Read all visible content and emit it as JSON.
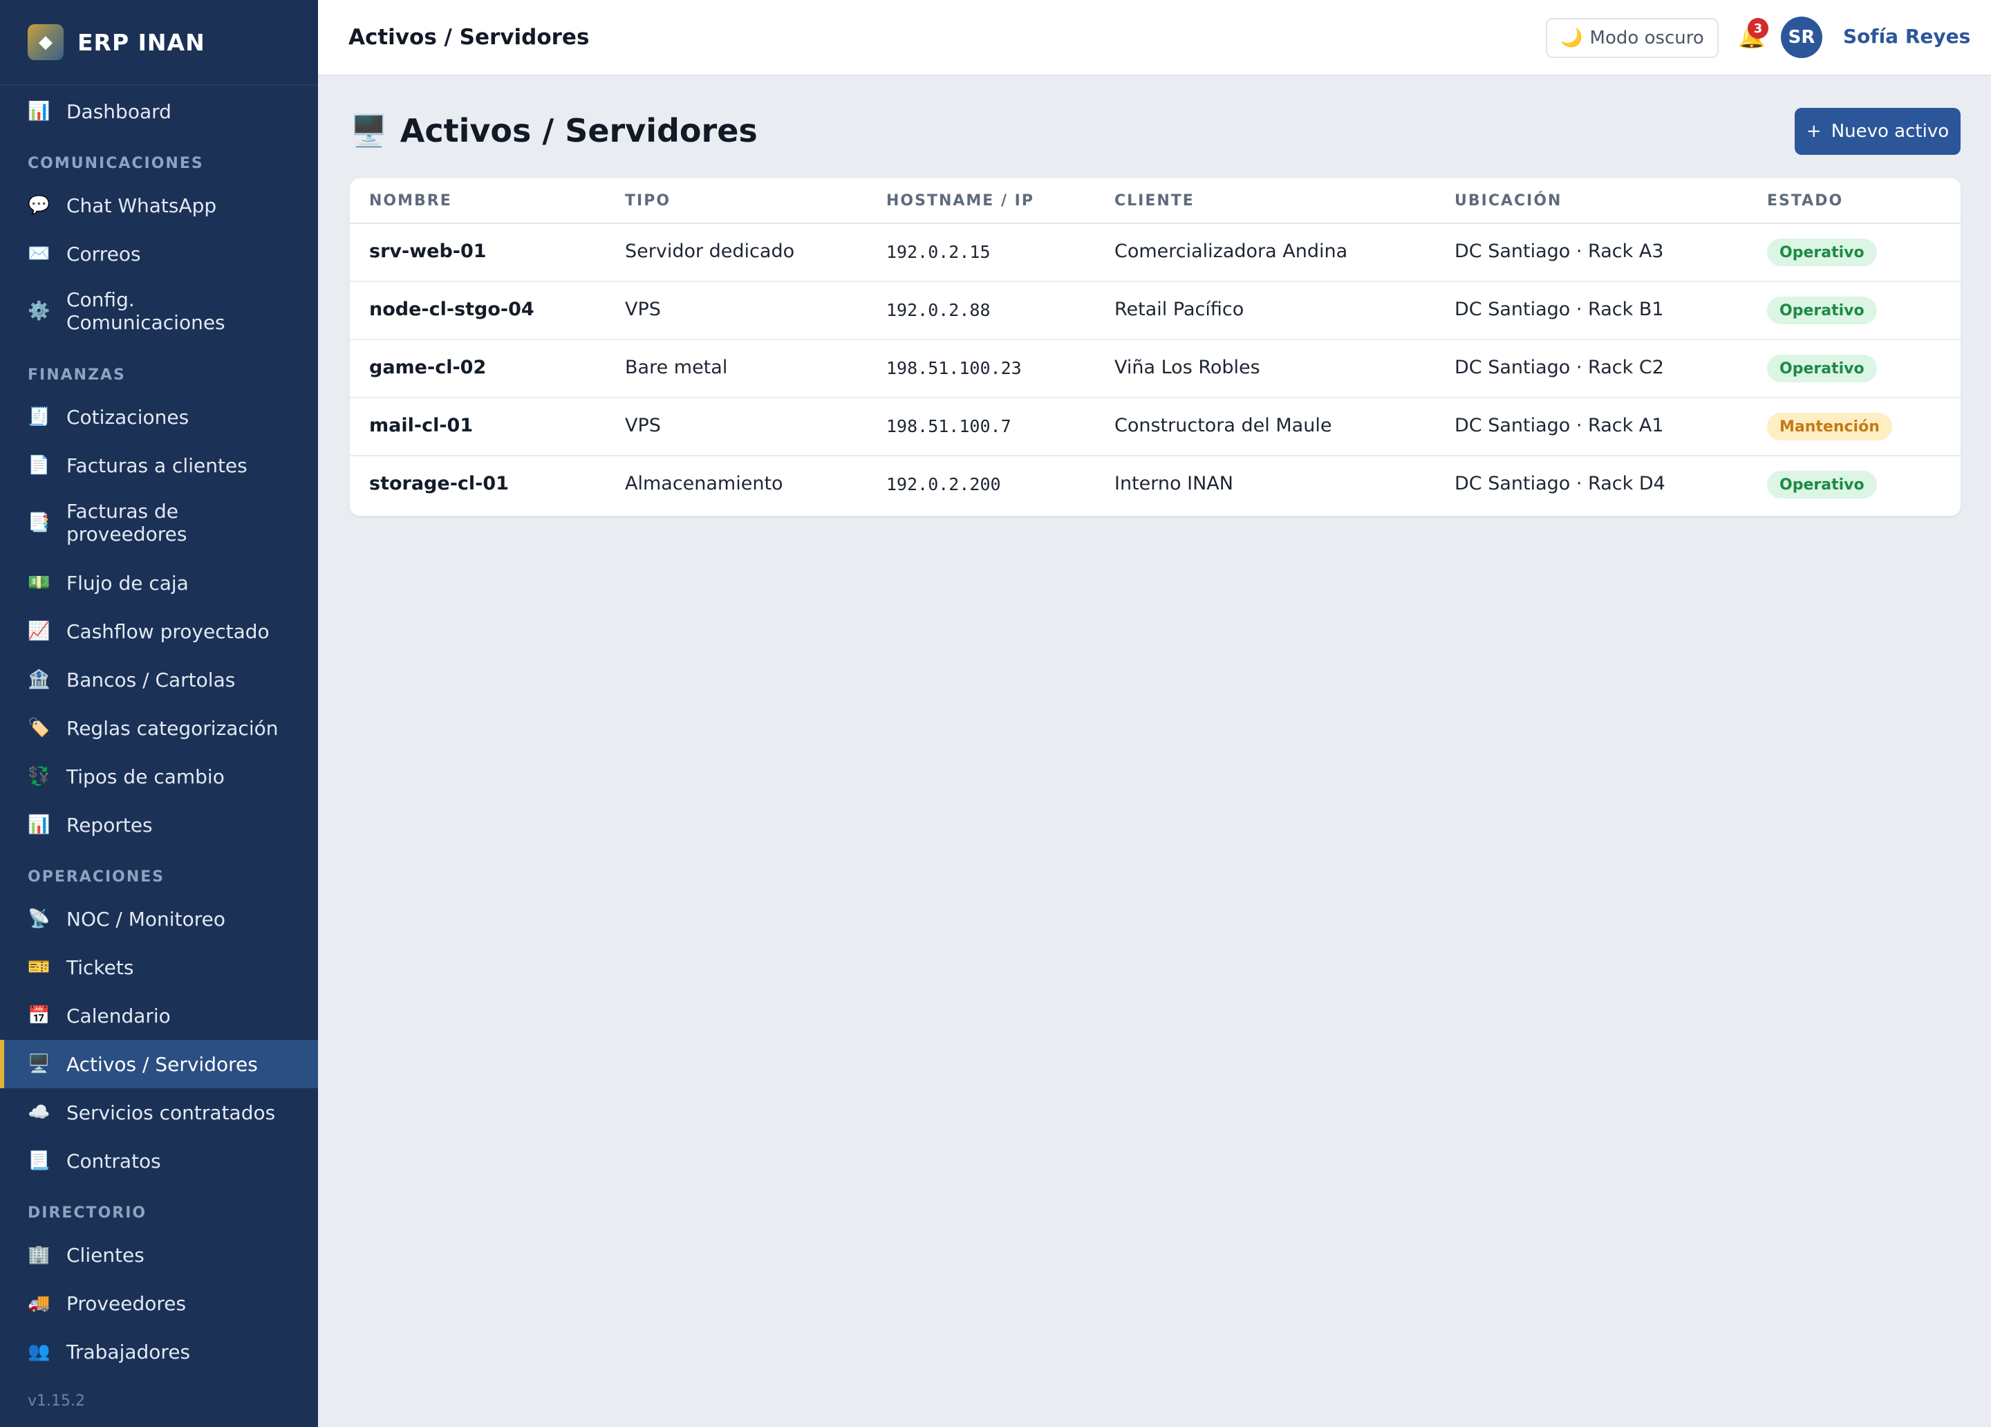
{
  "app": {
    "name": "ERP INAN",
    "logo_icon": "◆",
    "version": "v1.15.2"
  },
  "sidebar": {
    "dashboard": {
      "label": "Dashboard",
      "icon": "📊"
    },
    "sections": {
      "comunicaciones": "COMUNICACIONES",
      "finanzas": "FINANZAS",
      "operaciones": "OPERACIONES",
      "directorio": "DIRECTORIO"
    },
    "comunicaciones": [
      {
        "label": "Chat WhatsApp",
        "icon": "💬"
      },
      {
        "label": "Correos",
        "icon": "✉️"
      },
      {
        "label": "Config. Comunicaciones",
        "icon": "⚙️"
      }
    ],
    "finanzas": [
      {
        "label": "Cotizaciones",
        "icon": "🧾"
      },
      {
        "label": "Facturas a clientes",
        "icon": "📄"
      },
      {
        "label": "Facturas de proveedores",
        "icon": "📑"
      },
      {
        "label": "Flujo de caja",
        "icon": "💵"
      },
      {
        "label": "Cashflow proyectado",
        "icon": "📈"
      },
      {
        "label": "Bancos / Cartolas",
        "icon": "🏦"
      },
      {
        "label": "Reglas categorización",
        "icon": "🏷️"
      },
      {
        "label": "Tipos de cambio",
        "icon": "💱"
      },
      {
        "label": "Reportes",
        "icon": "📊"
      }
    ],
    "operaciones": [
      {
        "label": "NOC / Monitoreo",
        "icon": "📡"
      },
      {
        "label": "Tickets",
        "icon": "🎫"
      },
      {
        "label": "Calendario",
        "icon": "📅"
      },
      {
        "label": "Activos / Servidores",
        "icon": "🖥️"
      },
      {
        "label": "Servicios contratados",
        "icon": "☁️"
      },
      {
        "label": "Contratos",
        "icon": "📃"
      }
    ],
    "directorio": [
      {
        "label": "Clientes",
        "icon": "🏢"
      },
      {
        "label": "Proveedores",
        "icon": "🚚"
      },
      {
        "label": "Trabajadores",
        "icon": "👥"
      }
    ]
  },
  "topbar": {
    "title": "Activos / Servidores",
    "dark_mode_label": "Modo oscuro",
    "dark_mode_icon": "🌙",
    "bell_icon": "🔔",
    "notification_count": "3",
    "user_initials": "SR",
    "user_name": "Sofía Reyes"
  },
  "main": {
    "heading": "Activos / Servidores",
    "heading_icon": "🖥️",
    "new_button": {
      "plus": "+",
      "label": "Nuevo activo"
    },
    "table": {
      "headers": [
        "NOMBRE",
        "TIPO",
        "HOSTNAME / IP",
        "CLIENTE",
        "UBICACIÓN",
        "ESTADO"
      ],
      "rows": [
        [
          "srv-web-01",
          "Servidor dedicado",
          "192.0.2.15",
          "Comercializadora Andina",
          "DC Santiago · Rack A3",
          "Operativo"
        ],
        [
          "node-cl-stgo-04",
          "VPS",
          "192.0.2.88",
          "Retail Pacífico",
          "DC Santiago · Rack B1",
          "Operativo"
        ],
        [
          "game-cl-02",
          "Bare metal",
          "198.51.100.23",
          "Viña Los Robles",
          "DC Santiago · Rack C2",
          "Operativo"
        ],
        [
          "mail-cl-01",
          "VPS",
          "198.51.100.7",
          "Constructora del Maule",
          "DC Santiago · Rack A1",
          "Mantención"
        ],
        [
          "storage-cl-01",
          "Almacenamiento",
          "192.0.2.200",
          "Interno INAN",
          "DC Santiago · Rack D4",
          "Operativo"
        ]
      ]
    }
  },
  "colors": {
    "sidebar_bg": "#1b3156",
    "accent": "#2c569a",
    "active_marker": "#e2b33a",
    "status_ok": "#1d8a45",
    "status_warn": "#c47a12"
  }
}
